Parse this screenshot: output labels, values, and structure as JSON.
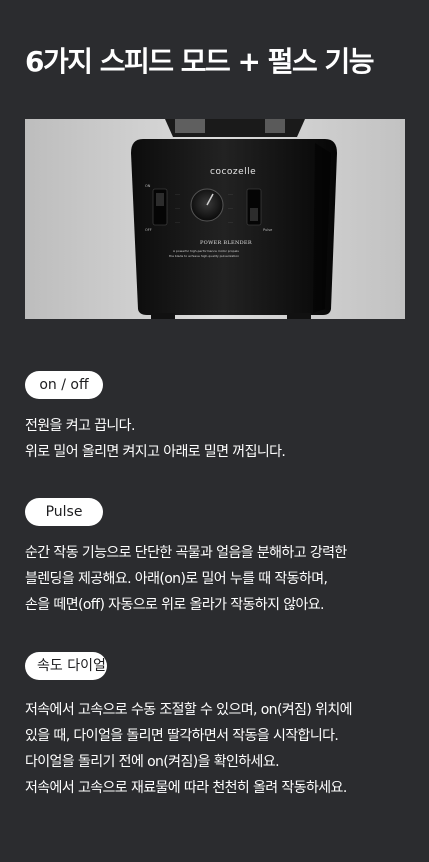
{
  "title": "6가지 스피드 모드 + 펄스 기능",
  "image": {
    "brand": "cocozelle",
    "model": "POWER BLENDER",
    "tagline_1": "A powerful high-performance motor propels",
    "tagline_2": "the blade to achieve high-quality pulverization"
  },
  "sections": [
    {
      "label": "on / off",
      "lines": [
        "전원을 켜고 끕니다.",
        "위로 밀어 올리면 켜지고 아래로 밀면 꺼집니다."
      ]
    },
    {
      "label": "Pulse",
      "lines": [
        "순간 작동 기능으로 단단한 곡물과 얼음을 분해하고 강력한",
        "블렌딩을 제공해요. 아래(on)로 밀어 누를 때 작동하며,",
        "손을 떼면(off) 자동으로 위로 올라가 작동하지 않아요."
      ]
    },
    {
      "label": "속도 다이얼",
      "lines": [
        "저속에서 고속으로 수동 조절할 수 있으며, on(켜짐) 위치에",
        "있을 때, 다이얼을 돌리면 딸각하면서 작동을 시작합니다.",
        "다이얼을 돌리기 전에 on(켜짐)을 확인하세요.",
        "저속에서 고속으로 재료물에 따라 천천히 올려 작동하세요."
      ]
    }
  ]
}
